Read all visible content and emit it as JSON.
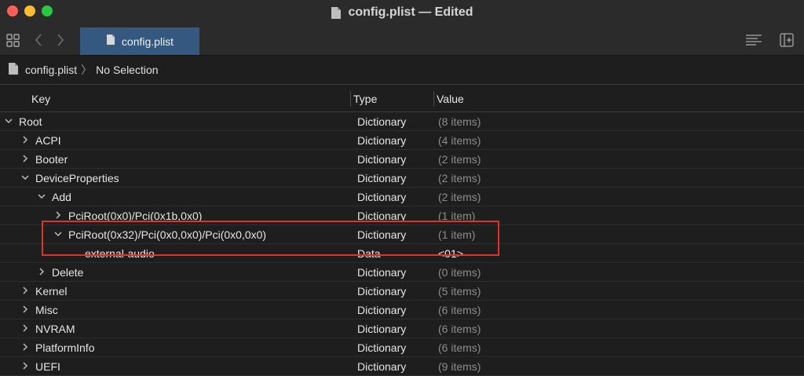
{
  "window": {
    "title": "config.plist — Edited"
  },
  "toolbar": {
    "tab_label": "config.plist"
  },
  "breadcrumb": {
    "file": "config.plist",
    "selection": "No Selection"
  },
  "columns": {
    "key": "Key",
    "type": "Type",
    "value": "Value"
  },
  "rows": [
    {
      "key": "Root",
      "type": "Dictionary",
      "value": "(8 items)",
      "depth": 0,
      "expanded": true
    },
    {
      "key": "ACPI",
      "type": "Dictionary",
      "value": "(4 items)",
      "depth": 1,
      "expanded": false
    },
    {
      "key": "Booter",
      "type": "Dictionary",
      "value": "(2 items)",
      "depth": 1,
      "expanded": false
    },
    {
      "key": "DeviceProperties",
      "type": "Dictionary",
      "value": "(2 items)",
      "depth": 1,
      "expanded": true
    },
    {
      "key": "Add",
      "type": "Dictionary",
      "value": "(2 items)",
      "depth": 2,
      "expanded": true
    },
    {
      "key": "PciRoot(0x0)/Pci(0x1b,0x0)",
      "type": "Dictionary",
      "value": "(1 item)",
      "depth": 3,
      "expanded": false
    },
    {
      "key": "PciRoot(0x32)/Pci(0x0,0x0)/Pci(0x0,0x0)",
      "type": "Dictionary",
      "value": "(1 item)",
      "depth": 3,
      "expanded": true
    },
    {
      "key": "external-audio",
      "type": "Data",
      "value": "<01>",
      "depth": 4,
      "leaf": true
    },
    {
      "key": "Delete",
      "type": "Dictionary",
      "value": "(0 items)",
      "depth": 2,
      "expanded": false
    },
    {
      "key": "Kernel",
      "type": "Dictionary",
      "value": "(5 items)",
      "depth": 1,
      "expanded": false
    },
    {
      "key": "Misc",
      "type": "Dictionary",
      "value": "(6 items)",
      "depth": 1,
      "expanded": false
    },
    {
      "key": "NVRAM",
      "type": "Dictionary",
      "value": "(6 items)",
      "depth": 1,
      "expanded": false
    },
    {
      "key": "PlatformInfo",
      "type": "Dictionary",
      "value": "(6 items)",
      "depth": 1,
      "expanded": false
    },
    {
      "key": "UEFI",
      "type": "Dictionary",
      "value": "(9 items)",
      "depth": 1,
      "expanded": false
    }
  ],
  "icons": {
    "grid": "grid-icon",
    "back": "chevron-left-icon",
    "forward": "chevron-right-icon",
    "document": "document-icon",
    "lines": "text-lines-icon",
    "inspector": "inspector-icon"
  }
}
